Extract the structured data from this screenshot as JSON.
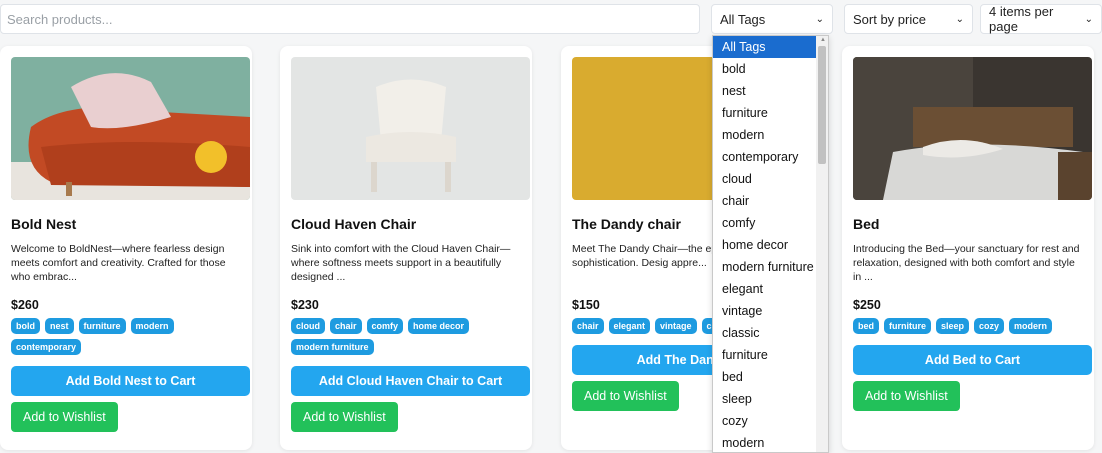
{
  "search": {
    "placeholder": "Search products...",
    "value": ""
  },
  "filters": {
    "tags_selected": "All Tags",
    "sort_selected": "Sort by price",
    "per_page_selected": "4 items per page"
  },
  "tag_options": [
    "All Tags",
    "bold",
    "nest",
    "furniture",
    "modern",
    "contemporary",
    "cloud",
    "chair",
    "comfy",
    "home decor",
    "modern furniture",
    "elegant",
    "vintage",
    "classic",
    "furniture",
    "bed",
    "sleep",
    "cozy",
    "modern"
  ],
  "products": [
    {
      "title": "Bold Nest",
      "description": "Welcome to BoldNest—where fearless design meets comfort and creativity. Crafted for those who embrac...",
      "price": "$260",
      "tags": [
        "bold",
        "nest",
        "furniture",
        "modern",
        "contemporary"
      ],
      "cart_label": "Add Bold Nest to Cart",
      "wishlist_label": "Add to Wishlist"
    },
    {
      "title": "Cloud Haven Chair",
      "description": "Sink into comfort with the Cloud Haven Chair—where softness meets support in a beautifully designed ...",
      "price": "$230",
      "tags": [
        "cloud",
        "chair",
        "comfy",
        "home decor",
        "modern furniture"
      ],
      "cart_label": "Add Cloud Haven Chair to Cart",
      "wishlist_label": "Add to Wishlist"
    },
    {
      "title": "The Dandy chair",
      "description": "Meet The Dandy Chair—the ep style, and sophistication. Desig appre...",
      "price": "$150",
      "tags": [
        "chair",
        "elegant",
        "vintage",
        "class"
      ],
      "cart_label": "Add The Dandy ch",
      "wishlist_label": "Add to Wishlist"
    },
    {
      "title": "Bed",
      "description": "Introducing the Bed—your sanctuary for rest and relaxation, designed with both comfort and style in ...",
      "price": "$250",
      "tags": [
        "bed",
        "furniture",
        "sleep",
        "cozy",
        "modern"
      ],
      "cart_label": "Add Bed to Cart",
      "wishlist_label": "Add to Wishlist"
    }
  ],
  "colors": {
    "tag": "#1e9be0",
    "cart": "#23a6ef",
    "wishlist": "#22c15a",
    "selected_option": "#1a6ccf"
  }
}
